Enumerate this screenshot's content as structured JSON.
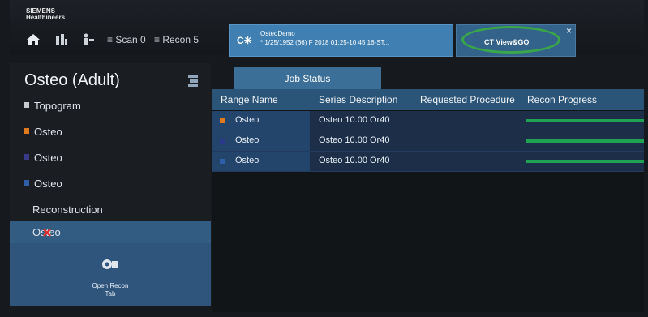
{
  "brand": {
    "line1": "SIEMENS",
    "line2": "Healthineers"
  },
  "nav": {
    "scan": "Scan 0",
    "recon": "Recon 5"
  },
  "patient_tab": {
    "ct": "C",
    "name": "OsteoDemo",
    "info": "* 1/25/1952 (66) F 2018 01:25-10 45 16-ST..."
  },
  "viewgo_tab": {
    "label": "CT View&GO",
    "close": "×"
  },
  "sidebar": {
    "title": "Osteo (Adult)",
    "items": [
      {
        "label": "Topogram",
        "color": "#c8ccd0"
      },
      {
        "label": "Osteo",
        "color": "#e07a1f"
      },
      {
        "label": "Osteo",
        "color": "#3a3a8a"
      },
      {
        "label": "Osteo",
        "color": "#2e5fa8"
      },
      {
        "label": "Reconstruction",
        "color": ""
      },
      {
        "label": "Osteo",
        "color": ""
      }
    ],
    "open_recon": {
      "line1": "Open Recon",
      "line2": "Tab"
    }
  },
  "job_status": {
    "tab_label": "Job Status",
    "columns": [
      "Range Name",
      "Series Description",
      "Requested Procedure",
      "Recon Progress"
    ],
    "rows": [
      {
        "range": "Osteo",
        "series": "Osteo 10.00 Or40",
        "procedure": "",
        "progress_pct": 100,
        "color": "#e07a1f"
      },
      {
        "range": "Osteo",
        "series": "Osteo 10.00 Or40",
        "procedure": "",
        "progress_pct": 100,
        "color": "#2a3a88"
      },
      {
        "range": "Osteo",
        "series": "Osteo 10.00 Or40",
        "procedure": "",
        "progress_pct": 100,
        "color": "#2e5fa8"
      }
    ]
  },
  "colors": {
    "accent": "#3f7fb1",
    "progress": "#1fa352",
    "highlight_ring": "#3aa64a"
  }
}
